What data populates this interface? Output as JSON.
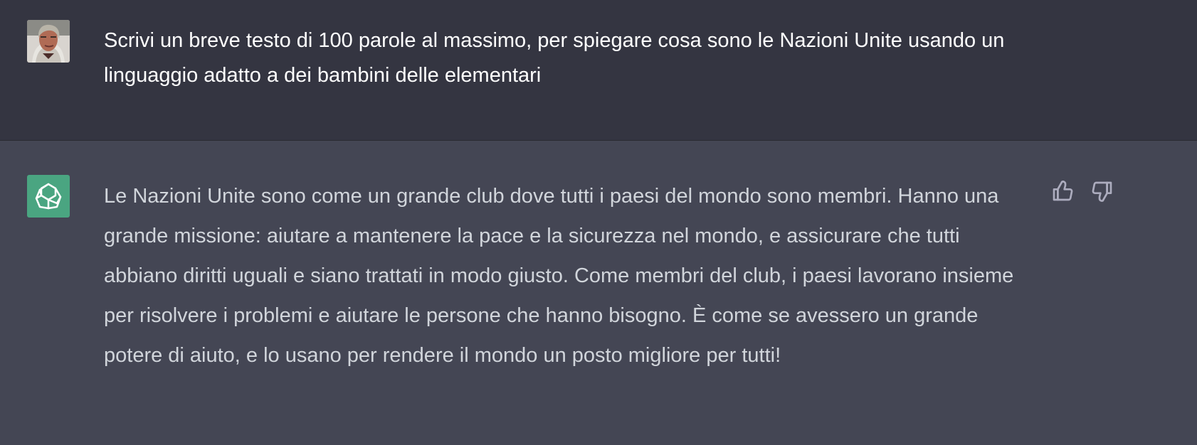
{
  "conversation": {
    "user_turn": {
      "avatar": "user-photo-avatar",
      "text": "Scrivi un breve testo di 100 parole al massimo, per spiegare cosa sono le Nazioni Unite usando un linguaggio adatto a dei bambini delle elementari"
    },
    "assistant_turn": {
      "avatar": "openai-logo-icon",
      "text": "Le Nazioni Unite sono come un grande club dove tutti i paesi del mondo sono membri. Hanno una grande missione: aiutare a mantenere la pace e la sicurezza nel mondo, e assicurare che tutti abbiano diritti uguali e siano trattati in modo giusto. Come membri del club, i paesi lavorano insieme per risolvere i problemi e aiutare le persone che hanno bisogno. È come se avessero un grande potere di aiuto, e lo usano per rendere il mondo un posto migliore per tutti!",
      "feedback": {
        "like_icon": "thumbs-up-icon",
        "dislike_icon": "thumbs-down-icon"
      }
    }
  },
  "colors": {
    "user_background": "#343541",
    "assistant_background": "#444654",
    "assistant_avatar": "#4aa581",
    "icon": "#acacbe",
    "text": "#ffffff"
  }
}
